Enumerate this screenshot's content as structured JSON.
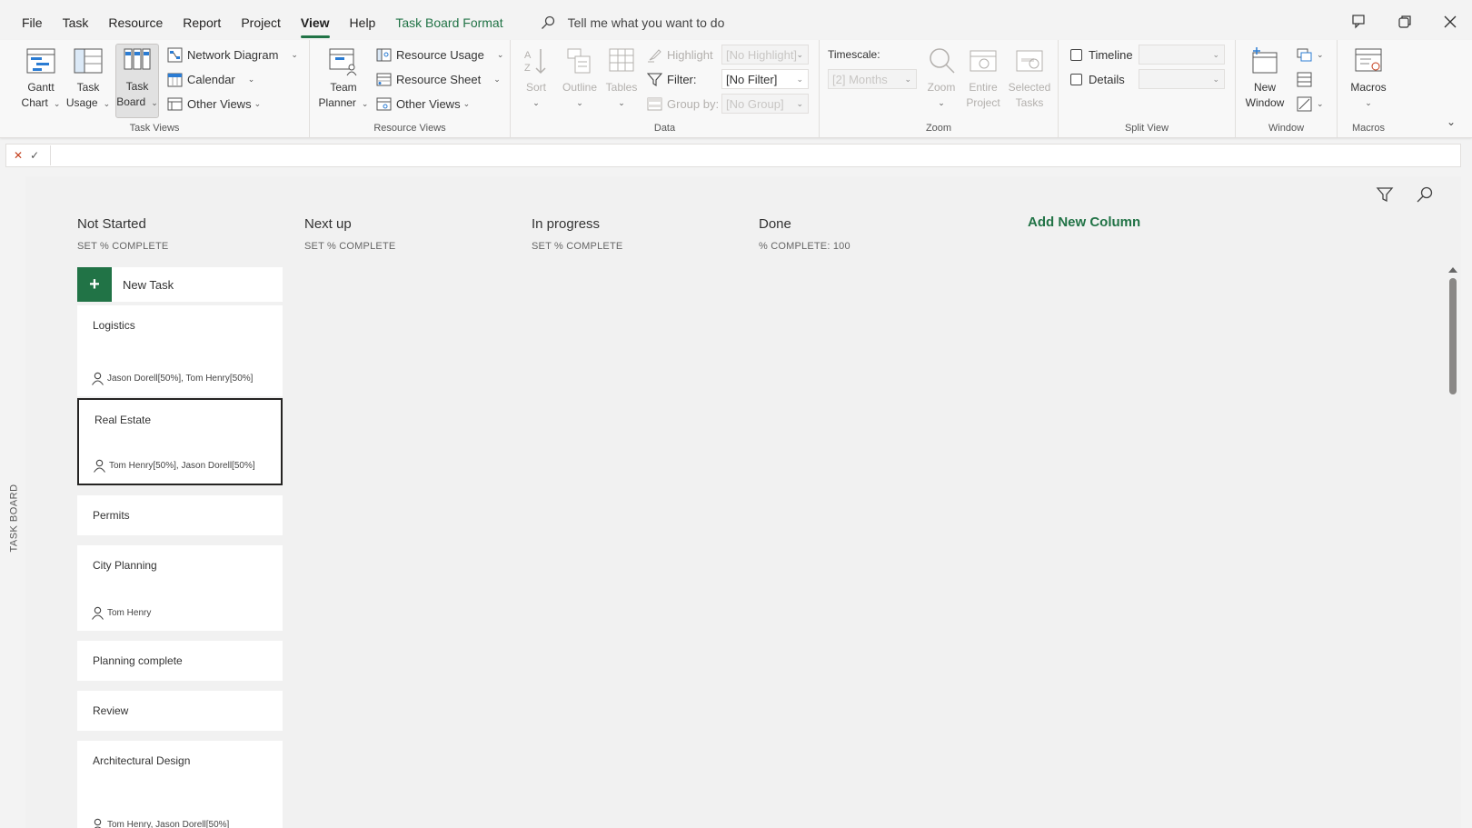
{
  "menu": {
    "items": [
      "File",
      "Task",
      "Resource",
      "Report",
      "Project",
      "View",
      "Help"
    ],
    "contextual_tab": "Task Board Format",
    "tell_me": "Tell me what you want to do"
  },
  "ribbon": {
    "task_views": {
      "gantt": "Gantt\nChart",
      "gantt_l1": "Gantt",
      "gantt_l2": "Chart",
      "task_usage_l1": "Task",
      "task_usage_l2": "Usage",
      "task_board_l1": "Task",
      "task_board_l2": "Board",
      "network_diagram": "Network Diagram",
      "calendar": "Calendar",
      "other_views": "Other Views",
      "label": "Task Views"
    },
    "resource_views": {
      "team_planner_l1": "Team",
      "team_planner_l2": "Planner",
      "resource_usage": "Resource Usage",
      "resource_sheet": "Resource Sheet",
      "other_views": "Other Views",
      "label": "Resource Views"
    },
    "data": {
      "sort": "Sort",
      "outline": "Outline",
      "tables": "Tables",
      "highlight": "Highlight",
      "highlight_value": "[No Highlight]",
      "filter": "Filter:",
      "filter_value": "[No Filter]",
      "group_by": "Group by:",
      "group_value": "[No Group]",
      "label": "Data"
    },
    "zoom": {
      "timescale": "Timescale:",
      "timescale_value": "[2] Months",
      "zoom": "Zoom",
      "entire_l1": "Entire",
      "entire_l2": "Project",
      "selected_l1": "Selected",
      "selected_l2": "Tasks",
      "label": "Zoom"
    },
    "split_view": {
      "timeline": "Timeline",
      "details": "Details",
      "label": "Split View"
    },
    "window": {
      "new_window_l1": "New",
      "new_window_l2": "Window",
      "label": "Window"
    },
    "macros": {
      "macros": "Macros",
      "label": "Macros"
    }
  },
  "board": {
    "side_label": "TASK BOARD",
    "columns": [
      {
        "title": "Not Started",
        "sub": "SET % COMPLETE"
      },
      {
        "title": "Next up",
        "sub": "SET % COMPLETE"
      },
      {
        "title": "In progress",
        "sub": "SET % COMPLETE"
      },
      {
        "title": "Done",
        "sub": "% COMPLETE: 100"
      }
    ],
    "add_column": "Add New Column",
    "new_task": "New Task",
    "cards": [
      {
        "title": "Logistics",
        "resources": "Jason Dorell[50%], Tom Henry[50%]"
      },
      {
        "title": "Real Estate",
        "resources": "Tom Henry[50%], Jason Dorell[50%]"
      },
      {
        "title": "Permits",
        "resources": ""
      },
      {
        "title": "City Planning",
        "resources": "Tom Henry"
      },
      {
        "title": "Planning complete",
        "resources": ""
      },
      {
        "title": "Review",
        "resources": ""
      },
      {
        "title": "Architectural Design",
        "resources": "Tom Henry, Jason Dorell[50%]"
      }
    ]
  }
}
